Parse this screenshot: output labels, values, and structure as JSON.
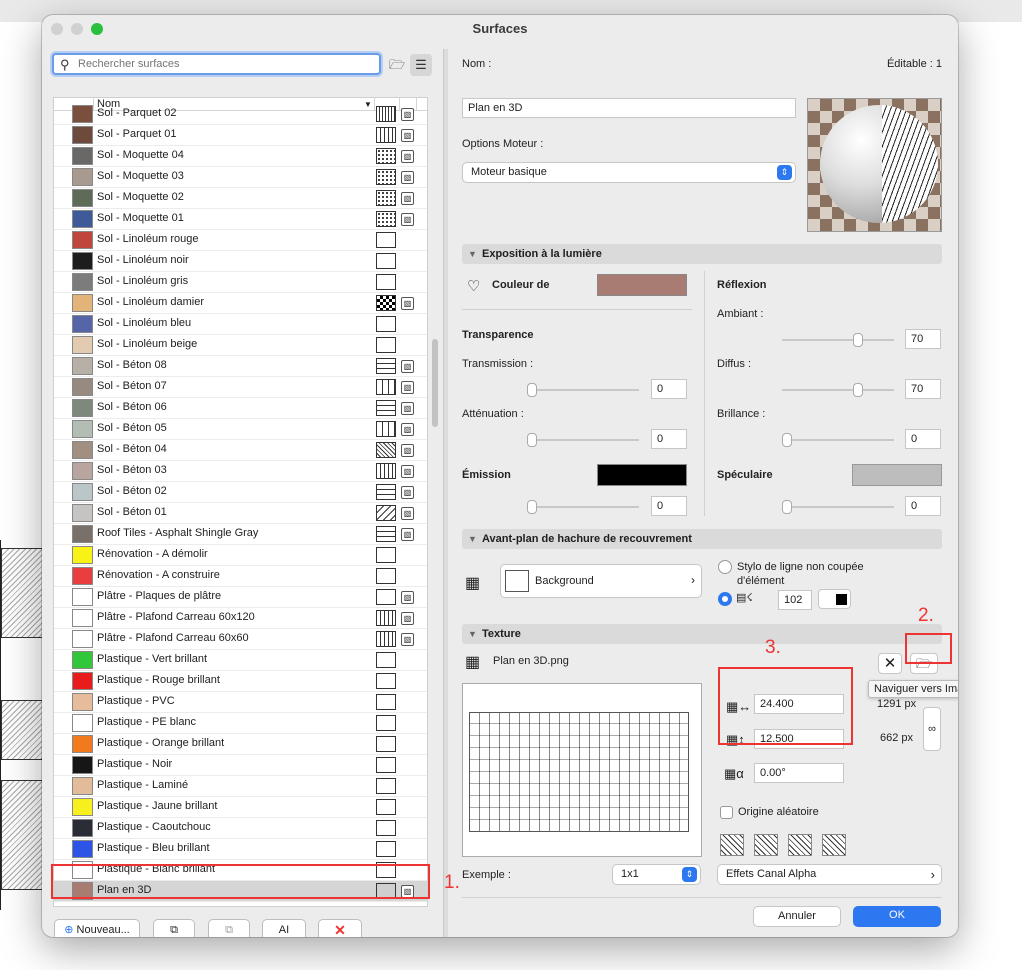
{
  "window": {
    "title": "Surfaces"
  },
  "search": {
    "placeholder": "Rechercher surfaces"
  },
  "list": {
    "column_name": "Nom",
    "items": [
      {
        "name": "Sol - Parquet 02",
        "color": "#7a4f3e",
        "pattern": "lines"
      },
      {
        "name": "Sol - Parquet 01",
        "color": "#6e4a3c",
        "pattern": "grid"
      },
      {
        "name": "Sol - Moquette 04",
        "color": "#6a6866",
        "pattern": "dots"
      },
      {
        "name": "Sol - Moquette 03",
        "color": "#a99a8f",
        "pattern": "dots"
      },
      {
        "name": "Sol - Moquette 02",
        "color": "#5d6b58",
        "pattern": "dots"
      },
      {
        "name": "Sol - Moquette 01",
        "color": "#3e5a98",
        "pattern": "dots"
      },
      {
        "name": "Sol - Linoléum rouge",
        "color": "#c0463c",
        "pattern": "empty"
      },
      {
        "name": "Sol - Linoléum noir",
        "color": "#1d1d1d",
        "pattern": "empty"
      },
      {
        "name": "Sol - Linoléum gris",
        "color": "#7c7c7c",
        "pattern": "empty"
      },
      {
        "name": "Sol - Linoléum damier",
        "color": "#e2b47a",
        "pattern": "check"
      },
      {
        "name": "Sol - Linoléum bleu",
        "color": "#5565a8",
        "pattern": "empty"
      },
      {
        "name": "Sol - Linoléum beige",
        "color": "#e3cbb2",
        "pattern": "empty"
      },
      {
        "name": "Sol - Béton 08",
        "color": "#b6b0a6",
        "pattern": "brick"
      },
      {
        "name": "Sol - Béton 07",
        "color": "#978b80",
        "pattern": "blocks"
      },
      {
        "name": "Sol - Béton 06",
        "color": "#7f887c",
        "pattern": "brick"
      },
      {
        "name": "Sol - Béton 05",
        "color": "#b3bdb4",
        "pattern": "blocks"
      },
      {
        "name": "Sol - Béton 04",
        "color": "#a18f82",
        "pattern": "hatch"
      },
      {
        "name": "Sol - Béton 03",
        "color": "#b9a5a0",
        "pattern": "grid"
      },
      {
        "name": "Sol - Béton 02",
        "color": "#bac6c7",
        "pattern": "brick"
      },
      {
        "name": "Sol - Béton 01",
        "color": "#c6c4c2",
        "pattern": "diag"
      },
      {
        "name": "Roof Tiles - Asphalt Shingle Gray",
        "color": "#7a706a",
        "pattern": "brick"
      },
      {
        "name": "Rénovation - A démolir",
        "color": "#f8f217",
        "pattern": "empty"
      },
      {
        "name": "Rénovation - A construire",
        "color": "#ea3d3d",
        "pattern": "empty"
      },
      {
        "name": "Plâtre - Plaques de plâtre",
        "color": "#ffffff",
        "pattern": "empty"
      },
      {
        "name": "Plâtre - Plafond Carreau 60x120",
        "color": "#ffffff",
        "pattern": "grid"
      },
      {
        "name": "Plâtre - Plafond Carreau 60x60",
        "color": "#ffffff",
        "pattern": "grid"
      },
      {
        "name": "Plastique - Vert brillant",
        "color": "#30c83a",
        "pattern": "empty"
      },
      {
        "name": "Plastique - Rouge brillant",
        "color": "#e81c1c",
        "pattern": "empty"
      },
      {
        "name": "Plastique - PVC",
        "color": "#e6bc9c",
        "pattern": "empty"
      },
      {
        "name": "Plastique - PE blanc",
        "color": "#ffffff",
        "pattern": "empty"
      },
      {
        "name": "Plastique - Orange brillant",
        "color": "#f27a1e",
        "pattern": "empty"
      },
      {
        "name": "Plastique - Noir",
        "color": "#161616",
        "pattern": "empty"
      },
      {
        "name": "Plastique - Laminé",
        "color": "#e2bc9a",
        "pattern": "empty"
      },
      {
        "name": "Plastique - Jaune brillant",
        "color": "#f8ef1e",
        "pattern": "empty"
      },
      {
        "name": "Plastique - Caoutchouc",
        "color": "#2a2d35",
        "pattern": "empty"
      },
      {
        "name": "Plastique - Bleu brillant",
        "color": "#2d54e6",
        "pattern": "empty"
      },
      {
        "name": "Plastique - Blanc brillant",
        "color": "#ffffff",
        "pattern": "empty"
      },
      {
        "name": "Plan en 3D",
        "color": "#a87c70",
        "pattern": "gray",
        "selected": true
      }
    ]
  },
  "bottom_buttons": {
    "new": "Nouveau...",
    "text_glyph": "AI"
  },
  "props": {
    "name_label": "Nom :",
    "editable": "Éditable : 1",
    "name_value": "Plan en 3D",
    "engine_label": "Options Moteur :",
    "engine_value": "Moteur basique"
  },
  "light": {
    "title": "Exposition à la lumière",
    "color_label": "Couleur de",
    "color": "#a87c72",
    "reflection": "Réflexion",
    "ambient_label": "Ambiant :",
    "ambient": "70",
    "diffuse_label": "Diffus :",
    "diffuse": "70",
    "shine_label": "Brillance :",
    "shine": "0",
    "transparency": "Transparence",
    "transmission_label": "Transmission :",
    "transmission": "0",
    "attenuation_label": "Atténuation :",
    "attenuation": "0",
    "emission": "Émission",
    "emission_value": "0",
    "emission_color": "#000000",
    "specular": "Spéculaire",
    "specular_value": "0",
    "specular_color": "#bdbdbd"
  },
  "overlay": {
    "title": "Avant-plan de hachure de recouvrement",
    "background": "Background",
    "uncut_label": "Stylo de ligne non coupée d'élément",
    "pen": "102"
  },
  "texture": {
    "title": "Texture",
    "file": "Plan en 3D.png",
    "width": "24.400",
    "height": "12.500",
    "width_px": "1291 px",
    "height_px": "662 px",
    "angle": "0.00°",
    "random_origin": "Origine aléatoire",
    "tooltip": "Naviguer vers Image",
    "example_label": "Exemple :",
    "example_value": "1x1",
    "alpha": "Effets Canal Alpha"
  },
  "annotations": {
    "a1": "1.",
    "a2": "2.",
    "a3": "3."
  },
  "dialog": {
    "cancel": "Annuler",
    "ok": "OK"
  }
}
